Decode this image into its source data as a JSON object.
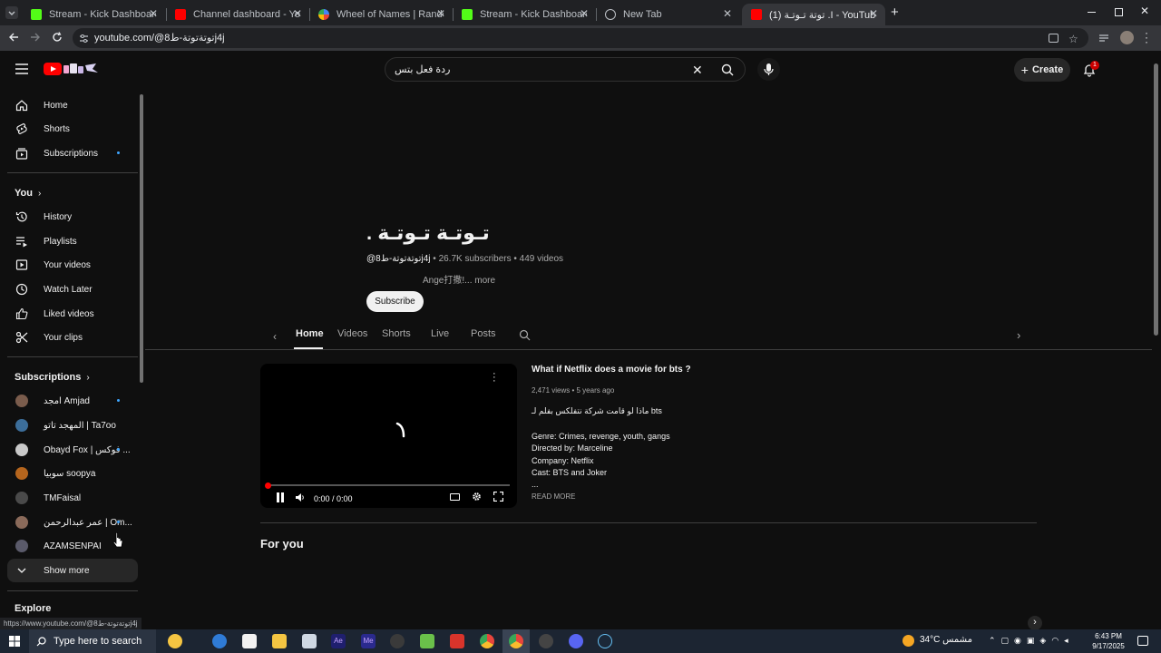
{
  "browser": {
    "tabs": [
      {
        "title": "Stream - Kick Dashboard",
        "color": "#53fc18"
      },
      {
        "title": "Channel dashboard - YouTube",
        "color": "#ff0000"
      },
      {
        "title": "Wheel of Names | Random nam",
        "color": "#4285f4"
      },
      {
        "title": "Stream - Kick Dashboard",
        "color": "#53fc18"
      },
      {
        "title": "New Tab",
        "color": "#bdc1c6"
      },
      {
        "title": "(1) توتة تـوتـة .I - YouTube",
        "color": "#ff0000"
      }
    ],
    "url": "youtube.com/@توتةتوتة-ط8j4j"
  },
  "header": {
    "search_value": "ردة فعل بتس",
    "create_label": "Create",
    "notification_count": "1"
  },
  "sidebar": {
    "main": [
      {
        "label": "Home",
        "icon": "home-icon"
      },
      {
        "label": "Shorts",
        "icon": "shorts-icon"
      },
      {
        "label": "Subscriptions",
        "icon": "subscriptions-icon"
      }
    ],
    "you_heading": "You",
    "you": [
      {
        "label": "History",
        "icon": "history-icon"
      },
      {
        "label": "Playlists",
        "icon": "playlists-icon"
      },
      {
        "label": "Your videos",
        "icon": "your-videos-icon"
      },
      {
        "label": "Watch Later",
        "icon": "watch-later-icon"
      },
      {
        "label": "Liked videos",
        "icon": "liked-icon"
      },
      {
        "label": "Your clips",
        "icon": "clips-icon"
      }
    ],
    "subs_heading": "Subscriptions",
    "subscriptions": [
      {
        "label": "امجد Amjad",
        "color": "#7a5c4c"
      },
      {
        "label": "المهجد تاتو | Ta7oo",
        "color": "#3c6e9a"
      },
      {
        "label": "Obayd Fox | فوكس ...",
        "color": "#c9c9c9"
      },
      {
        "label": "سوبيا soopya",
        "color": "#b5651d"
      },
      {
        "label": "TMFaisal",
        "color": "#4a4a4a"
      },
      {
        "label": "عمر عبدالرحمن | Om...",
        "color": "#8a6a5a"
      },
      {
        "label": "AZAMSENPAI",
        "color": "#5a5a6a"
      }
    ],
    "show_more": "Show more",
    "explore_heading": "Explore"
  },
  "channel": {
    "name": ". تـوتـة تـوتـة",
    "handle": "@توتةتوتة-ط8j4j",
    "subscribers": "26.7K subscribers",
    "videos": "449 videos",
    "description": "Ange​打撒!... more",
    "subscribe_label": "Subscribe",
    "tabs": [
      "Home",
      "Videos",
      "Shorts",
      "Live",
      "Posts"
    ]
  },
  "featured": {
    "time": "0:00 / 0:00",
    "title": "What if Netflix does a movie for bts ?",
    "stats": "2,471 views • 5 years ago",
    "desc_lines": [
      "ماذا لو قامت شركة نتفلكس بفلم لـ bts",
      "",
      "Genre: Crimes, revenge, youth, gangs",
      "Directed by: Marceline",
      "Company: Netflix",
      "Cast: BTS and Joker",
      "..."
    ],
    "read_more": "READ MORE"
  },
  "sections": {
    "for_you": "For you"
  },
  "status_url": "https://www.youtube.com/@توتةتوتة-ط8j4j",
  "taskbar": {
    "search_placeholder": "Type here to search",
    "weather": "34°C مشمس",
    "time": "6:43 PM",
    "date": "9/17/2025",
    "apps": [
      {
        "name": "copilot-app",
        "color": "#f5c542"
      },
      {
        "name": "edge-app",
        "color": "#2f7bd6"
      },
      {
        "name": "store-app",
        "color": "#f2f2f2"
      },
      {
        "name": "explorer-app",
        "color": "#f4c542"
      },
      {
        "name": "notepad-app",
        "color": "#cfd8e3"
      },
      {
        "name": "after-effects-app",
        "color": "#1f1f6e"
      },
      {
        "name": "media-encoder-app",
        "color": "#2a2a8e"
      },
      {
        "name": "obs-app",
        "color": "#3a3a3a"
      },
      {
        "name": "puzzle-app",
        "color": "#6ac04a"
      },
      {
        "name": "red-app",
        "color": "#d9342b"
      },
      {
        "name": "chrome-app",
        "color": "#e8453c"
      },
      {
        "name": "chrome-app-2",
        "color": "#e8453c"
      },
      {
        "name": "github-app",
        "color": "#444444"
      },
      {
        "name": "discord-app",
        "color": "#5865f2"
      },
      {
        "name": "steam-app",
        "color": "#1b2838"
      }
    ]
  }
}
